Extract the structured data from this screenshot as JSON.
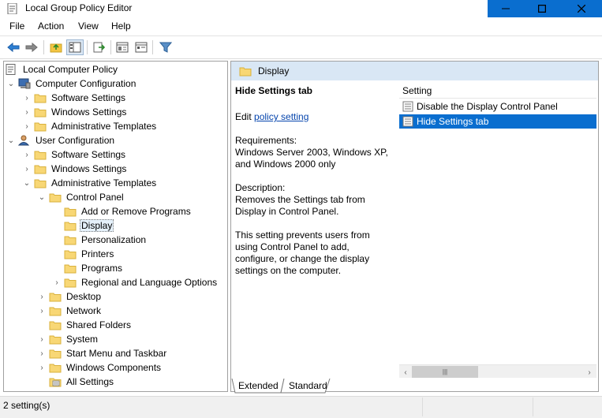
{
  "window": {
    "title": "Local Group Policy Editor",
    "accent": "#0a6ecf"
  },
  "menu": [
    "File",
    "Action",
    "View",
    "Help"
  ],
  "toolbar": {
    "icons": [
      "back-arrow-icon",
      "forward-arrow-icon",
      "up-folder-icon",
      "show-hide-tree-icon",
      "export-list-icon",
      "properties-icon",
      "filter-icon"
    ]
  },
  "tree": {
    "nodes": [
      {
        "label": "Local Computer Policy",
        "icon": "policy-doc-icon",
        "expander": "none"
      },
      {
        "label": "Computer Configuration",
        "icon": "computer-icon",
        "expander": "expanded"
      },
      {
        "label": "Software Settings",
        "icon": "folder-icon",
        "expander": "collapsed"
      },
      {
        "label": "Windows Settings",
        "icon": "folder-icon",
        "expander": "collapsed"
      },
      {
        "label": "Administrative Templates",
        "icon": "folder-icon",
        "expander": "collapsed"
      },
      {
        "label": "User Configuration",
        "icon": "user-icon",
        "expander": "expanded"
      },
      {
        "label": "Software Settings",
        "icon": "folder-icon",
        "expander": "collapsed"
      },
      {
        "label": "Windows Settings",
        "icon": "folder-icon",
        "expander": "collapsed"
      },
      {
        "label": "Administrative Templates",
        "icon": "folder-icon",
        "expander": "expanded"
      },
      {
        "label": "Control Panel",
        "icon": "folder-icon",
        "expander": "expanded"
      },
      {
        "label": "Add or Remove Programs",
        "icon": "folder-icon",
        "expander": "none"
      },
      {
        "label": "Display",
        "icon": "folder-icon",
        "expander": "none",
        "selected": true
      },
      {
        "label": "Personalization",
        "icon": "folder-icon",
        "expander": "none"
      },
      {
        "label": "Printers",
        "icon": "folder-icon",
        "expander": "none"
      },
      {
        "label": "Programs",
        "icon": "folder-icon",
        "expander": "none"
      },
      {
        "label": "Regional and Language Options",
        "icon": "folder-icon",
        "expander": "collapsed"
      },
      {
        "label": "Desktop",
        "icon": "folder-icon",
        "expander": "collapsed"
      },
      {
        "label": "Network",
        "icon": "folder-icon",
        "expander": "collapsed"
      },
      {
        "label": "Shared Folders",
        "icon": "folder-icon",
        "expander": "none"
      },
      {
        "label": "System",
        "icon": "folder-icon",
        "expander": "collapsed"
      },
      {
        "label": "Start Menu and Taskbar",
        "icon": "folder-icon",
        "expander": "collapsed"
      },
      {
        "label": "Windows Components",
        "icon": "folder-icon",
        "expander": "collapsed"
      },
      {
        "label": "All Settings",
        "icon": "all-settings-icon",
        "expander": "none"
      }
    ]
  },
  "right": {
    "header": "Display",
    "description": {
      "title": "Hide Settings tab",
      "edit_prefix": "Edit ",
      "edit_link": "policy setting",
      "req_label": "Requirements:",
      "req_text": "Windows Server 2003, Windows XP, and Windows 2000 only",
      "desc_label": "Description:",
      "desc_text": "Removes the Settings tab from Display in Control Panel.",
      "detail": "This setting prevents users from using Control Panel to add, configure, or change the display settings on the computer."
    },
    "list": {
      "column": "Setting",
      "rows": [
        {
          "label": "Disable the Display Control Panel",
          "selected": false
        },
        {
          "label": "Hide Settings tab",
          "selected": true
        }
      ]
    },
    "tabs": [
      "Extended",
      "Standard"
    ]
  },
  "status": {
    "text": "2 setting(s)"
  }
}
